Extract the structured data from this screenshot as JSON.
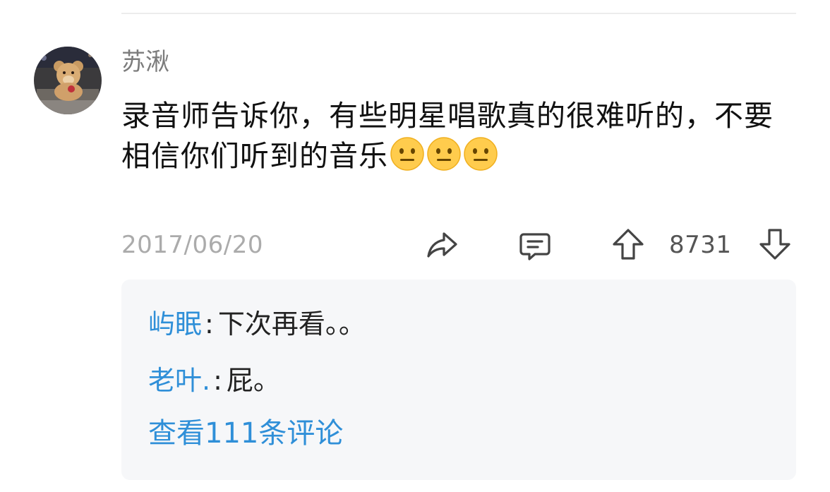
{
  "comment": {
    "author": "苏湫",
    "text": "录音师告诉你，有些明星唱歌真的很难听的，不要相信你们听到的音乐",
    "emojis": [
      "neutral-face",
      "neutral-face",
      "neutral-face"
    ],
    "date": "2017/06/20",
    "votes": "8731"
  },
  "replies": [
    {
      "user": "屿眠",
      "sep": ":",
      "text": "下次再看。。"
    },
    {
      "user": "老叶.",
      "sep": ":",
      "text": "屁。"
    }
  ],
  "view_more": "查看111条评论",
  "colors": {
    "link": "#2f8fd8",
    "reply_bg": "#f6f7f9",
    "muted": "#ababab"
  }
}
